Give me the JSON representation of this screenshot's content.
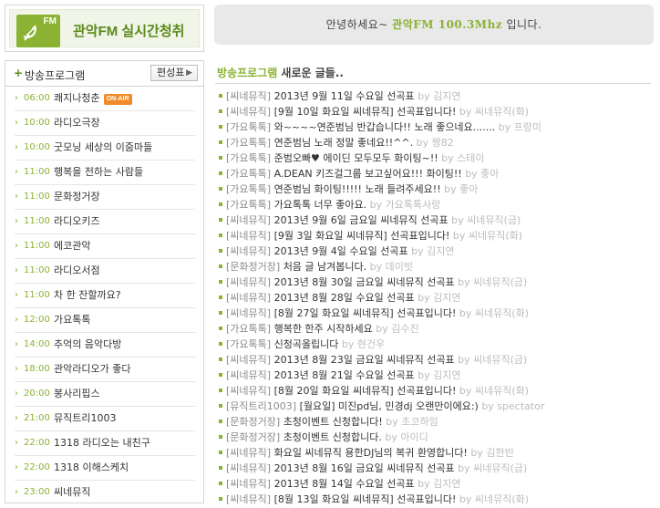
{
  "listen": {
    "title": "관악FM 실시간청취",
    "logo_text": "FM"
  },
  "greeting": {
    "prefix": "안녕하세요~ ",
    "highlight": "관악FM 100.3Mhz",
    "suffix": " 입니다."
  },
  "program": {
    "header": "방송프로그램",
    "schedule_label": "편성표",
    "onair_badge": "ON-AIR",
    "items": [
      {
        "time": "06:00",
        "name": "쾌지나청춘",
        "onair": true
      },
      {
        "time": "10:00",
        "name": "라디오극장"
      },
      {
        "time": "10:00",
        "name": "굿모닝 세상의 이줌마들"
      },
      {
        "time": "11:00",
        "name": "행복을 전하는 사람들"
      },
      {
        "time": "11:00",
        "name": "문화정거장"
      },
      {
        "time": "11:00",
        "name": "라디오키즈"
      },
      {
        "time": "11:00",
        "name": "에코관악"
      },
      {
        "time": "11:00",
        "name": "라디오서점"
      },
      {
        "time": "11:00",
        "name": "차 한 잔할까요?"
      },
      {
        "time": "12:00",
        "name": "가요톡톡"
      },
      {
        "time": "14:00",
        "name": "추억의 음악다방"
      },
      {
        "time": "18:00",
        "name": "관악라디오가 좋다"
      },
      {
        "time": "20:00",
        "name": "봉사리핍스"
      },
      {
        "time": "21:00",
        "name": "뮤직트리1003"
      },
      {
        "time": "22:00",
        "name": "1318 라디오는 내친구"
      },
      {
        "time": "22:00",
        "name": "1318 이해스케치"
      },
      {
        "time": "23:00",
        "name": "씨네뮤직"
      }
    ]
  },
  "posts": {
    "title_green": "방송프로그램",
    "title_rest": " 새로운 글들..",
    "items": [
      {
        "cat": "[씨네뮤직]",
        "title": "2013년 9월 11일 수요일 선곡표",
        "by": "by 김지연"
      },
      {
        "cat": "[씨네뮤직]",
        "title": "[9월 10일 화요일 씨네뮤직] 선곡표입니다!",
        "by": "by 씨네뮤직(화)"
      },
      {
        "cat": "[가요톡톡]",
        "title": "와~~~~연준범님 반갑습니다!! 노래 좋으네요.......",
        "by": "by 프랑미"
      },
      {
        "cat": "[가요톡톡]",
        "title": "연준범님 노래 정말 좋네요!!^^.",
        "by": "by 짱82"
      },
      {
        "cat": "[가요톡톡]",
        "title": "준범오빠♥ 에이딘 모두모두 화이팅~!!",
        "by": "by 스테이"
      },
      {
        "cat": "[가요톡톡]",
        "title": "A.DEAN 키즈걸그룹 보고싶어요!!! 화이팅!!",
        "by": "by 좋아"
      },
      {
        "cat": "[가요톡톡]",
        "title": "연준범님 화이팅!!!!! 노래 들려주세요!!",
        "by": "by 좋아"
      },
      {
        "cat": "[가요톡톡]",
        "title": "가요톡톡 너무 좋아요.",
        "by": "by 가요톡톡사랑"
      },
      {
        "cat": "[씨네뮤직]",
        "title": "2013년 9월 6일 금요일 씨네뮤직 선곡표",
        "by": "by 씨네뮤직(금)"
      },
      {
        "cat": "[씨네뮤직]",
        "title": "[9월 3일 화요일 씨네뮤직] 선곡표입니다!",
        "by": "by 씨네뮤직(화)"
      },
      {
        "cat": "[씨네뮤직]",
        "title": "2013년 9월 4일 수요일 선곡표",
        "by": "by 김지연"
      },
      {
        "cat": "[문화정거장]",
        "title": "처음 글 남겨봅니다.",
        "by": "by 데이빗"
      },
      {
        "cat": "[씨네뮤직]",
        "title": "2013년 8월 30일 금요일 씨네뮤직 선곡표",
        "by": "by 씨네뮤직(금)"
      },
      {
        "cat": "[씨네뮤직]",
        "title": "2013년 8월 28일 수요일 선곡표",
        "by": "by 김지연"
      },
      {
        "cat": "[씨네뮤직]",
        "title": "[8월 27일 화요일 씨네뮤직] 선곡표입니다!",
        "by": "by 씨네뮤직(화)"
      },
      {
        "cat": "[가요톡톡]",
        "title": "행복한 한주 시작하세요",
        "by": "by 김수진"
      },
      {
        "cat": "[가요톡톡]",
        "title": "신청곡올립니다",
        "by": "by 현건우"
      },
      {
        "cat": "[씨네뮤직]",
        "title": "2013년 8월 23일 금요일 씨네뮤직 선곡표",
        "by": "by 씨네뮤직(금)"
      },
      {
        "cat": "[씨네뮤직]",
        "title": "2013년 8월 21일 수요일 선곡표",
        "by": "by 김지연"
      },
      {
        "cat": "[씨네뮤직]",
        "title": "[8월 20일 화요일 씨네뮤직] 선곡표입니다!",
        "by": "by 씨네뮤직(화)"
      },
      {
        "cat": "[뮤직트리1003]",
        "title": "[월요일] 미진pd님, 민경dj 오랜만이에요:)",
        "by": "by spectator"
      },
      {
        "cat": "[문화정거장]",
        "title": "초청이벤트 신청합니다!",
        "by": "by 초코하임"
      },
      {
        "cat": "[문화정거장]",
        "title": "초청이벤트 신청합니다.",
        "by": "by 아이디"
      },
      {
        "cat": "[씨네뮤직]",
        "title": "화요일 씨네뮤직 용한DJ님의 복귀 환영합니다!",
        "by": "by 김한빈"
      },
      {
        "cat": "[씨네뮤직]",
        "title": "2013년 8월 16일 금요일 씨네뮤직 선곡표",
        "by": "by 씨네뮤직(금)"
      },
      {
        "cat": "[씨네뮤직]",
        "title": "2013년 8월 14일 수요일 선곡표",
        "by": "by 김지연"
      },
      {
        "cat": "[씨네뮤직]",
        "title": "[8월 13일 화요일 씨네뮤직] 선곡표입니다!",
        "by": "by 씨네뮤직(화)"
      }
    ]
  },
  "colors": {
    "accent": "#8bb233",
    "onair": "#f08a2a",
    "meta": "#bcbcbc",
    "category": "#8b8b8b"
  },
  "icons": {
    "logo": "satellite-dish-icon",
    "list_bullet": "chevron-right-icon"
  }
}
